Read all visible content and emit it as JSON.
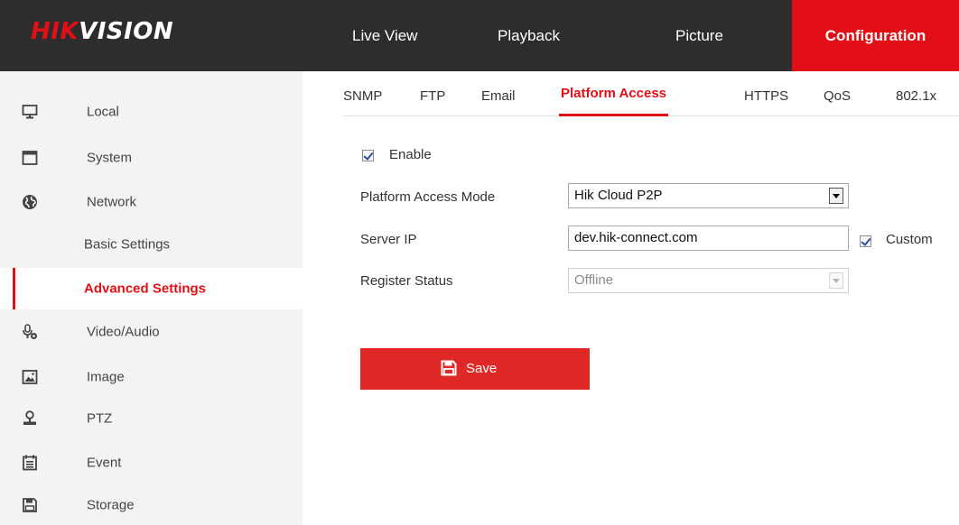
{
  "header": {
    "logo_red": "HIK",
    "logo_white": "VISION",
    "nav": [
      "Live View",
      "Playback",
      "Picture",
      "Configuration"
    ],
    "active_nav": "Configuration"
  },
  "sidebar": {
    "items": [
      {
        "label": "Local",
        "icon": "monitor-icon"
      },
      {
        "label": "System",
        "icon": "system-window-icon"
      },
      {
        "label": "Network",
        "icon": "globe-icon"
      },
      {
        "label": "Basic Settings"
      },
      {
        "label": "Advanced Settings",
        "selected": true
      },
      {
        "label": "Video/Audio",
        "icon": "microphone-icon"
      },
      {
        "label": "Image",
        "icon": "image-icon"
      },
      {
        "label": "PTZ",
        "icon": "ptz-icon"
      },
      {
        "label": "Event",
        "icon": "event-list-icon"
      },
      {
        "label": "Storage",
        "icon": "floppy-disk-icon"
      }
    ]
  },
  "tabs": {
    "items": [
      "SNMP",
      "FTP",
      "Email",
      "Platform Access",
      "HTTPS",
      "QoS",
      "802.1x"
    ],
    "active": "Platform Access"
  },
  "form": {
    "enable_label": "Enable",
    "enable_checked": true,
    "mode_label": "Platform Access Mode",
    "mode_value": "Hik Cloud P2P",
    "server_ip_label": "Server IP",
    "server_ip_value": "dev.hik-connect.com",
    "custom_label": "Custom",
    "custom_checked": true,
    "register_status_label": "Register Status",
    "register_status_value": "Offline",
    "save_label": "Save"
  },
  "colors": {
    "accent": "#e30f16",
    "header_bg": "#2d2d2d",
    "sidebar_bg": "#f3f3f3"
  }
}
